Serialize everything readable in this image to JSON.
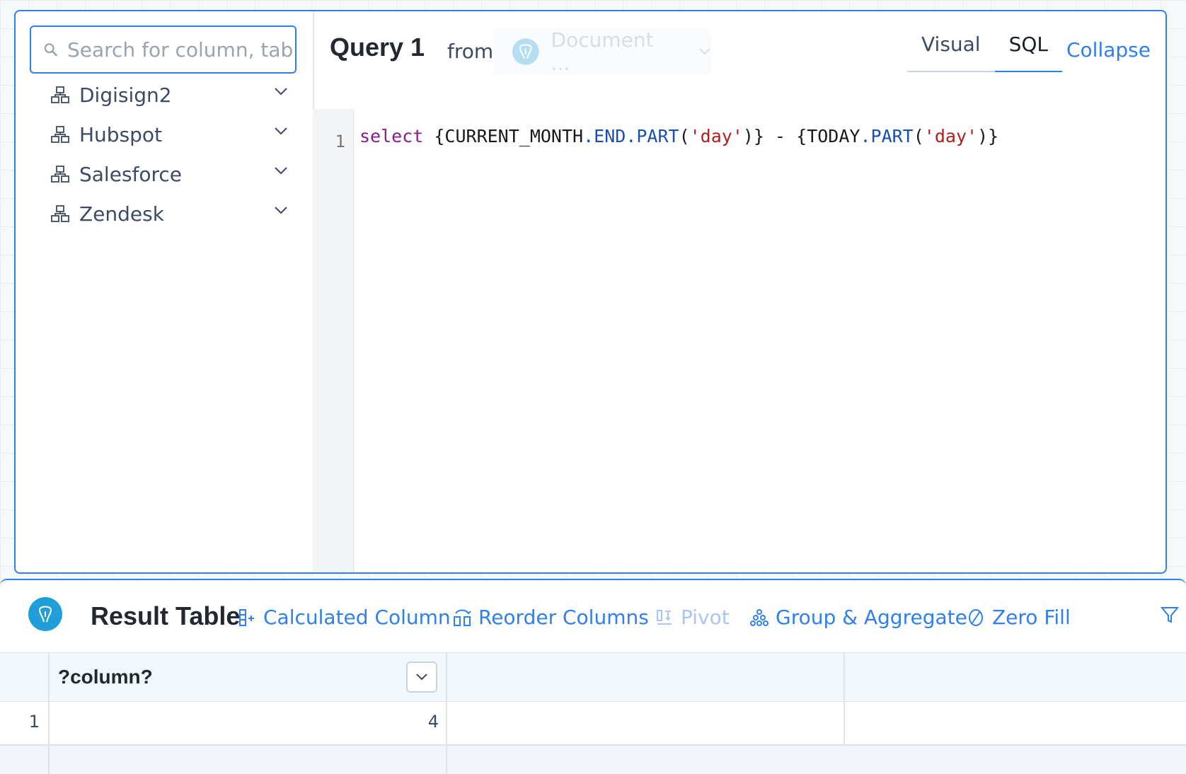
{
  "search": {
    "placeholder": "Search for column, table"
  },
  "schemas": [
    {
      "label": "Digisign2"
    },
    {
      "label": "Hubspot"
    },
    {
      "label": "Salesforce"
    },
    {
      "label": "Zendesk"
    }
  ],
  "query": {
    "title": "Query 1",
    "from_label": "from",
    "source": "Document ...",
    "tabs": [
      {
        "label": "Visual"
      },
      {
        "label": "SQL"
      }
    ],
    "active_tab": "SQL",
    "collapse_label": "Collapse",
    "line_number": "1",
    "code": {
      "kw_select": "select",
      "t1": " {CURRENT_MONTH",
      "f1": ".END.PART",
      "p1": "(",
      "s1": "'day'",
      "t2": ")} - {TODAY",
      "f2": ".PART",
      "p2": "(",
      "s2": "'day'",
      "t3": ")}"
    }
  },
  "result": {
    "title": "Result Table",
    "tools": {
      "calculated_column": "Calculated Column",
      "reorder_columns": "Reorder Columns",
      "pivot": "Pivot",
      "group_aggregate": "Group & Aggregate",
      "zero_fill": "Zero Fill"
    },
    "columns": [
      "?column?"
    ],
    "rows": [
      {
        "num": "1",
        "values": [
          "4"
        ]
      }
    ]
  },
  "colors": {
    "accent": "#2f80ed",
    "logo": "#1f9ed8"
  }
}
